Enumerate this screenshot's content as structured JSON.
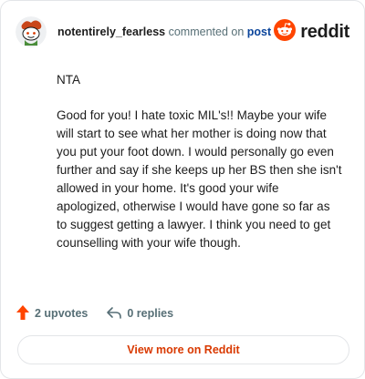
{
  "comment": {
    "username": "notentirely_fearless",
    "action_text": "commented on",
    "post_link_label": "post",
    "body_paragraphs": [
      "NTA",
      "Good for you! I hate toxic MIL's!! Maybe your wife will start to see what her mother is doing now that you put your foot down. I would personally go even further and say if she keeps up her BS then she isn't allowed in your home. It's good your wife apologized, otherwise I would have gone so far as to suggest getting a lawyer. I think you need to get counselling with your wife though."
    ]
  },
  "brand": {
    "wordmark": "reddit",
    "color": "#ff4500"
  },
  "stats": {
    "upvotes_label": "2 upvotes",
    "replies_label": "0 replies"
  },
  "actions": {
    "view_more_label": "View more on Reddit"
  },
  "colors": {
    "accent": "#d93900",
    "upvote": "#ff4500",
    "link": "#0a449b"
  },
  "icons": {
    "avatar": "snoo-avatar-icon",
    "upvote": "upvote-arrow-icon",
    "replies": "reply-arrow-icon",
    "brand": "reddit-logo-icon"
  }
}
